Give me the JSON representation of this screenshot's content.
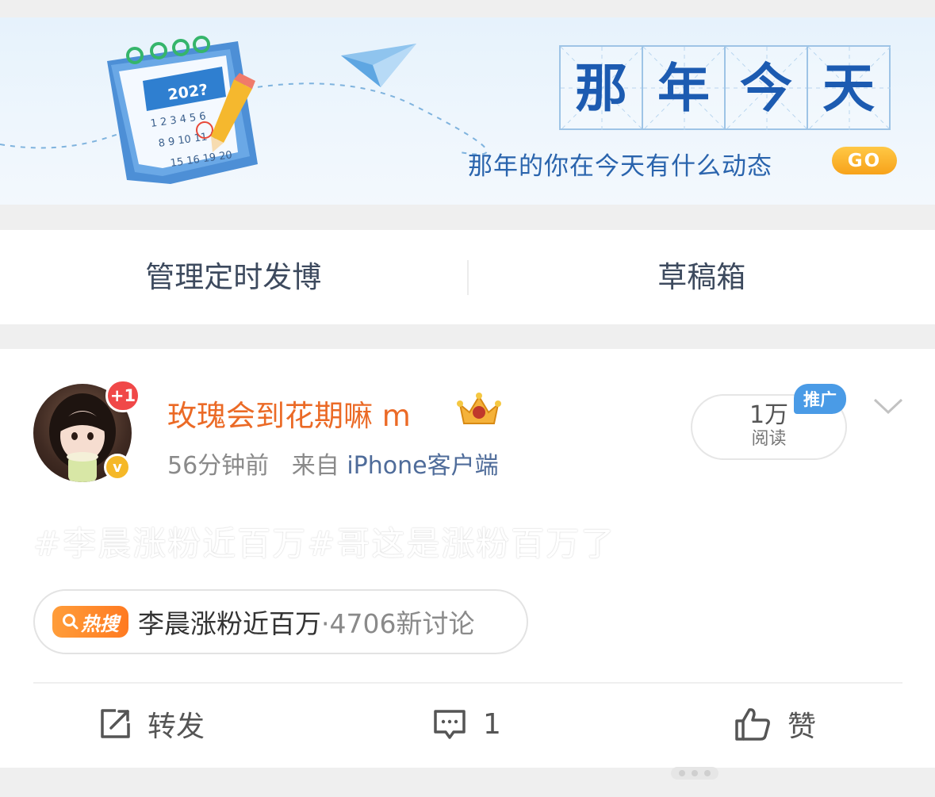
{
  "banner": {
    "title_chars": [
      "那",
      "年",
      "今",
      "天"
    ],
    "subtitle": "那年的你在今天有什么动态",
    "go_label": "GO",
    "calendar_year": "202?",
    "calendar_days": [
      "1 2 3 4 5 6",
      "8 9 10 11 12",
      "15 16 19 20"
    ],
    "calendar_icon": "calendar-icon",
    "plane_icon": "paper-plane-icon"
  },
  "tabs": {
    "scheduled": "管理定时发博",
    "drafts": "草稿箱"
  },
  "post": {
    "author": "玫瑰会到花期嘛 m",
    "new_badge": "+1",
    "verified_badge": "v",
    "time": "56分钟前",
    "source_prefix": "来自",
    "source_name": "iPhone客户端",
    "reads_count": "1万",
    "reads_label": "阅读",
    "promo_label": "推广",
    "text": "#李晨涨粉近百万#哥这是涨粉百万了",
    "hot_search": {
      "badge": "热搜",
      "topic": "李晨涨粉近百万",
      "count": "·4706新讨论"
    },
    "actions": {
      "repost": "转发",
      "comments": "1",
      "like": "赞"
    }
  },
  "colors": {
    "username": "#eb6a26",
    "banner_blue": "#1c5bb1",
    "go_button": "#f7a21a",
    "hot_badge": "#ff8a2a",
    "promo": "#4a9be6"
  }
}
